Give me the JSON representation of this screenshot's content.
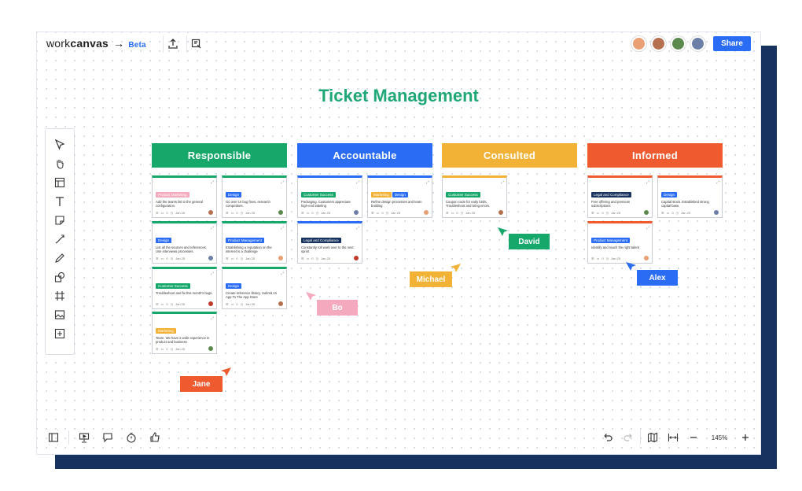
{
  "app": {
    "logo_light": "work",
    "logo_bold": "canvas",
    "logo_arrow": "→",
    "beta": "Beta",
    "share_label": "Share"
  },
  "board": {
    "title": "Ticket Management"
  },
  "columns": [
    {
      "label": "Responsible",
      "color": "#16a86b"
    },
    {
      "label": "Accountable",
      "color": "#2a6df4"
    },
    {
      "label": "Consulted",
      "color": "#f2b236"
    },
    {
      "label": "Informed",
      "color": "#ef5a2f"
    }
  ],
  "cards": {
    "r1": {
      "tag": "Product Marketing",
      "text": "Add the teams list to the general configuration.",
      "date": "Jan 25"
    },
    "r2": {
      "tag": "Design",
      "text": "Go over UI bug fixes, research competitors.",
      "date": "Jan 25"
    },
    "r3": {
      "tag": "Design",
      "text": "List all the sources and references. Use interviews processes.",
      "date": "Jan 25"
    },
    "r4": {
      "tag": "Product Management",
      "text": "Establishing a reputation on the internet is a challenge",
      "date": "Jan 25"
    },
    "r5": {
      "tag": "Customer Success",
      "text": "Troubleshoot and fix this month's bugs.",
      "date": "Jan 25"
    },
    "r6": {
      "tag": "Design",
      "text": "Create reference library. Submit An App To The App Store",
      "date": "Jan 25"
    },
    "r7": {
      "tag": "Marketing",
      "text": "Team. We have a wide experience in product and business",
      "date": "Jan 25"
    },
    "a1": {
      "tag": "Customer Success",
      "text": "Packaging. Customers appreciate high-end labeling",
      "date": "Jan 25"
    },
    "a2": {
      "tag": "Marketing",
      "tag2": "Design",
      "text": "Refine design processes and team building",
      "date": "Jan 25"
    },
    "a3": {
      "tag": "Legal and Compliance",
      "text": "Constantly roll work over to the next sprint",
      "date": "Jan 25"
    },
    "c1": {
      "tag": "Customer Success",
      "text": "Coupon code for early birds, Troubleshoot and bring errors.",
      "date": "Jan 25"
    },
    "i1": {
      "tag": "Legal and Compliance",
      "text": "Free offering and premium subscriptions",
      "date": "Jan 25"
    },
    "i2": {
      "tag": "Design",
      "text": "Capital stock. Established strong capital base.",
      "date": "Jan 25"
    },
    "i3": {
      "tag": "Product Management",
      "text": "Identify and reach the right talent",
      "date": "Jan 25"
    }
  },
  "cursors": {
    "david": {
      "name": "David",
      "color": "#16a86b"
    },
    "michael": {
      "name": "Michael",
      "color": "#f2b236"
    },
    "alex": {
      "name": "Alex",
      "color": "#2a6df4"
    },
    "bo": {
      "name": "Bo",
      "color": "#f5a9bf"
    },
    "jane": {
      "name": "Jane",
      "color": "#ef5a2f"
    }
  },
  "zoom": {
    "level": "145%"
  },
  "meta_counts": {
    "subtasks": "0",
    "comments": "0"
  }
}
